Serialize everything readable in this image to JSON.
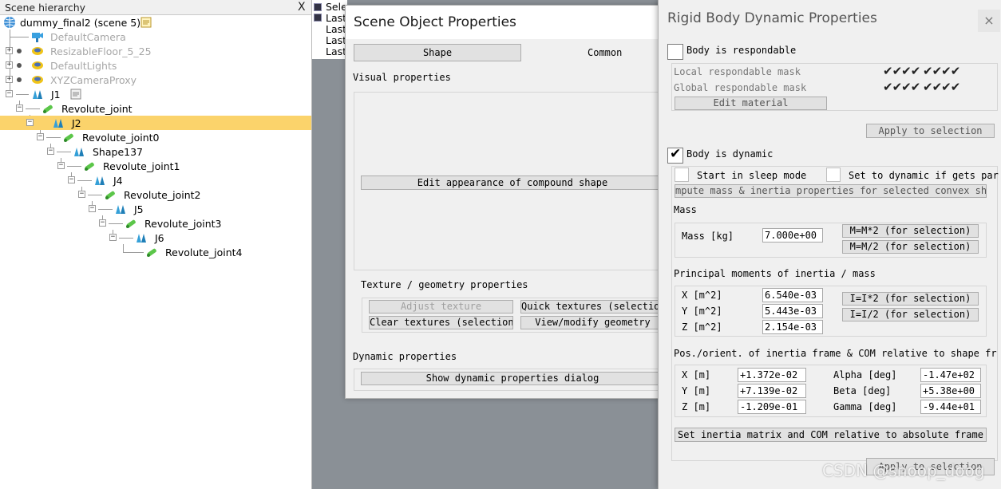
{
  "hierarchy": {
    "title": "Scene hierarchy",
    "close": "X",
    "scene": "dummy_final2 (scene 5)",
    "items": [
      {
        "label": "DefaultCamera"
      },
      {
        "label": "ResizableFloor_5_25"
      },
      {
        "label": "DefaultLights"
      },
      {
        "label": "XYZCameraProxy"
      },
      {
        "label": "J1"
      },
      {
        "label": "Revolute_joint"
      },
      {
        "label": "J2"
      },
      {
        "label": "Revolute_joint0"
      },
      {
        "label": "Shape137"
      },
      {
        "label": "Revolute_joint1"
      },
      {
        "label": "J4"
      },
      {
        "label": "Revolute_joint2"
      },
      {
        "label": "J5"
      },
      {
        "label": "Revolute_joint3"
      },
      {
        "label": "J6"
      },
      {
        "label": "Revolute_joint4"
      }
    ],
    "selected": "J2",
    "colors": {
      "selection": "#fbd36b",
      "dim_text": "#a7a7a7"
    }
  },
  "log": {
    "lines": [
      "Sele",
      "Last",
      "Last",
      "Last",
      "Last"
    ]
  },
  "scene_object_props": {
    "title": "Scene Object Properties",
    "tabs": [
      {
        "label": "Shape"
      },
      {
        "label": "Common"
      }
    ],
    "visual_heading": "Visual properties",
    "edit_appearance": "Edit appearance of compound shape",
    "texture_heading": "Texture / geometry properties",
    "adjust_texture": "Adjust texture",
    "quick_textures": "Quick textures (selection",
    "clear_textures": "Clear textures (selection)",
    "view_geometry": "View/modify geometry",
    "dynamic_heading": "Dynamic properties",
    "show_dynamic": "Show dynamic properties dialog"
  },
  "rigid_body": {
    "title": "Rigid Body Dynamic Properties",
    "close": "×",
    "respondable_label": "Body is respondable",
    "respondable_checked": false,
    "local_mask": "Local respondable mask",
    "global_mask": "Global respondable mask",
    "mask_checks": "✔✔✔✔ ✔✔✔✔",
    "edit_material": "Edit material",
    "apply_selection_1": "Apply to selection",
    "dynamic_label": "Body is dynamic",
    "dynamic_checked_mark": "✔",
    "sleep_mode": "Start in sleep mode",
    "set_dynamic": "Set to dynamic if gets par",
    "compute_mass": "mpute mass & inertia properties for selected convex shap",
    "mass_heading": "Mass",
    "mass_label": "Mass [kg]",
    "mass_value": "7.000e+00",
    "mass_x2": "M=M*2  (for selection)",
    "mass_d2": "M=M/2  (for selection)",
    "inertia_heading": "Principal moments of inertia / mass",
    "inertia_x_label": "X [m^2]",
    "inertia_y_label": "Y [m^2]",
    "inertia_z_label": "Z [m^2]",
    "inertia_x": "6.540e-03",
    "inertia_y": "5.443e-03",
    "inertia_z": "2.154e-03",
    "inertia_x2": "I=I*2  (for selection)",
    "inertia_d2": "I=I/2  (for selection)",
    "pos_heading": "Pos./orient. of inertia frame & COM relative to shape fr",
    "pos_x_label": "X [m]",
    "pos_y_label": "Y [m]",
    "pos_z_label": "Z [m]",
    "pos_x": "+1.372e-02",
    "pos_y": "+7.139e-02",
    "pos_z": "-1.209e-01",
    "alpha_label": "Alpha [deg]",
    "beta_label": "Beta [deg]",
    "gamma_label": "Gamma [deg]",
    "alpha": "-1.47e+02",
    "beta": "+5.38e+00",
    "gamma": "-9.44e+01",
    "set_inertia": "Set inertia matrix and COM relative to absolute frame",
    "apply_selection_2": "Apply to selection"
  },
  "watermark": "CSDN @snoop_doog"
}
